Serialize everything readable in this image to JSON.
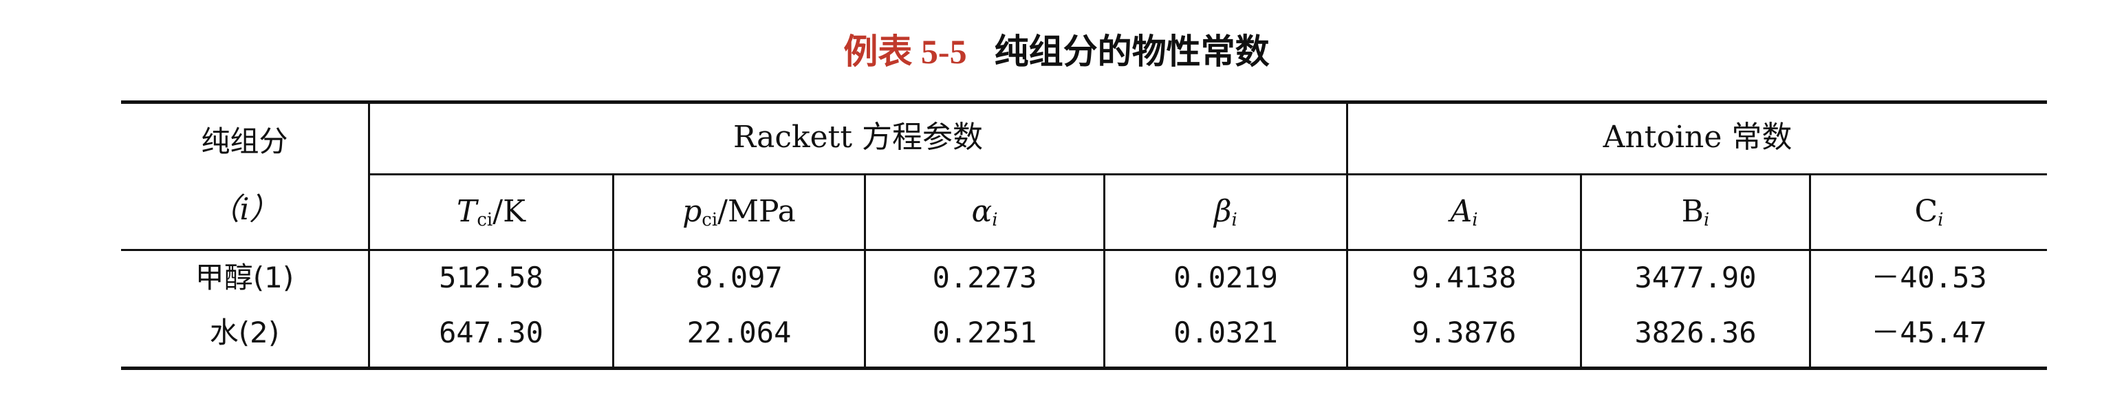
{
  "caption": {
    "label": "例表 5-5",
    "title": "纯组分的物性常数"
  },
  "header": {
    "component_label": "纯组分",
    "component_index": "（i）",
    "group_rackett": "Rackett 方程参数",
    "group_antoine": "Antoine 常数",
    "columns": {
      "tc_symbol": "T",
      "tc_sub": "ci",
      "tc_unit": "/K",
      "pc_symbol": "p",
      "pc_sub": "ci",
      "pc_unit": "/MPa",
      "alpha_symbol": "α",
      "alpha_sub": "i",
      "beta_symbol": "β",
      "beta_sub": "i",
      "a_symbol": "A",
      "a_sub": "i",
      "b_symbol": "B",
      "b_sub": "i",
      "c_symbol": "C",
      "c_sub": "i"
    }
  },
  "rows": [
    {
      "component": "甲醇(1)",
      "tc": "512.58",
      "pc": "8.097",
      "alpha": "0.2273",
      "beta": "0.0219",
      "a": "9.4138",
      "b": "3477.90",
      "c": "－40.53"
    },
    {
      "component": "水(2)",
      "tc": "647.30",
      "pc": "22.064",
      "alpha": "0.2251",
      "beta": "0.0321",
      "a": "9.3876",
      "b": "3826.36",
      "c": "－45.47"
    }
  ]
}
